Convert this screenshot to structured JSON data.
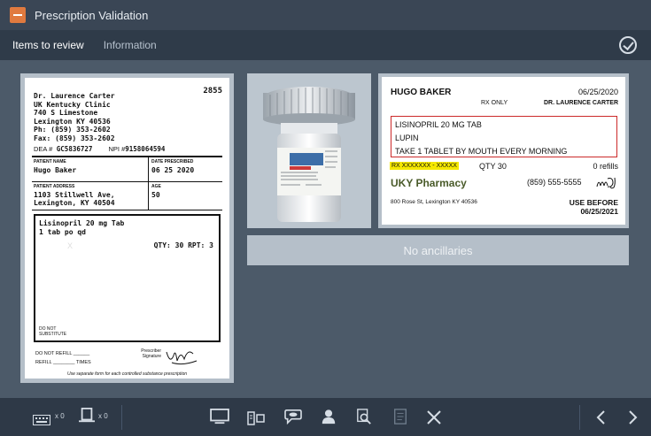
{
  "window": {
    "title": "Prescription Validation"
  },
  "tabs": [
    {
      "label": "Items to review",
      "active": true
    },
    {
      "label": "Information",
      "active": false
    }
  ],
  "prescription": {
    "number": "2855",
    "doctor_lines": [
      "Dr. Laurence Carter",
      "UK Kentucky Clinic",
      "740 S Limestone",
      "Lexington KY 40536",
      "Ph: (859) 353-2602",
      "Fax: (859) 353-2602"
    ],
    "dea_label": "DEA #",
    "dea": "GC5836727",
    "npi_label": "NPI #",
    "npi": "9158064594",
    "patient_name_label": "PATIENT NAME",
    "patient_name": "Hugo Baker",
    "date_label": "DATE PRESCRIBED",
    "date": "06 25 2020",
    "address_label": "PATIENT ADDRESS",
    "address": "1103 Stillwell Ave, Lexington, KY 40504",
    "age_label": "AGE",
    "age": "50",
    "drug_line1": "Lisinopril 20 mg Tab",
    "drug_line2": "1 tab po qd",
    "qty": "QTY: 30 RPT: 3",
    "watermark": "X",
    "do_not_substitute": "DO NOT SUBSTITUTE",
    "do_not_refill": "DO NOT REFILL",
    "refill": "REFILL",
    "times": "TIMES",
    "prescriber_signature": "Prescriber Signature",
    "footnote": "Use separate form for each controlled substance prescription"
  },
  "label": {
    "patient": "HUGO BAKER",
    "date": "06/25/2020",
    "rx_only": "RX ONLY",
    "doctor": "DR. LAURENCE CARTER",
    "drug": "LISINOPRIL 20 MG TAB",
    "manufacturer": "LUPIN",
    "directions": "TAKE 1 TABLET BY MOUTH EVERY MORNING",
    "rx_number": "RX XXXXXXX - XXXXX",
    "qty": "QTY 30",
    "refills": "0 refills",
    "pharmacy": "UKY Pharmacy",
    "phone": "(859) 555-5555",
    "initials": "mDJ",
    "address": "800 Rose St, Lexington KY 40536",
    "use_before_label": "USE BEFORE",
    "use_before_date": "06/25/2021"
  },
  "ancillaries": {
    "text": "No ancillaries"
  },
  "toolbar": {
    "count1": "x 0",
    "count2": "x 0"
  },
  "colors": {
    "accent": "#e07a3f",
    "highlight": "#f5e800",
    "alert_border": "#cc2a2a"
  }
}
